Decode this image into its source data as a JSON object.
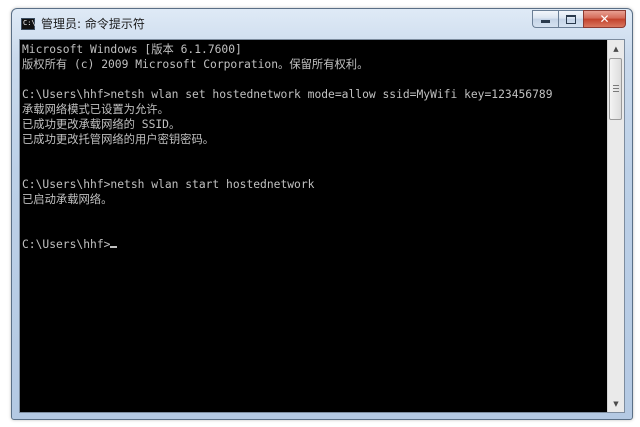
{
  "window": {
    "title": "管理员: 命令提示符",
    "icon": "cmd-icon",
    "icon_text": "C:\\",
    "minimize_icon": "minimize-icon",
    "maximize_icon": "maximize-icon",
    "close_icon": "close-icon",
    "close_glyph": "✕"
  },
  "console": {
    "lines": [
      "Microsoft Windows [版本 6.1.7600]",
      "版权所有 (c) 2009 Microsoft Corporation。保留所有权利。",
      "",
      "C:\\Users\\hhf>netsh wlan set hostednetwork mode=allow ssid=MyWifi key=123456789",
      "承载网络模式已设置为允许。",
      "已成功更改承载网络的 SSID。",
      "已成功更改托管网络的用户密钥密码。",
      "",
      "",
      "C:\\Users\\hhf>netsh wlan start hostednetwork",
      "已启动承载网络。",
      "",
      "",
      "C:\\Users\\hhf>"
    ],
    "text_color": "#c0c0c0",
    "background_color": "#000000"
  },
  "scrollbar": {
    "up_arrow": "▲",
    "down_arrow": "▼"
  }
}
